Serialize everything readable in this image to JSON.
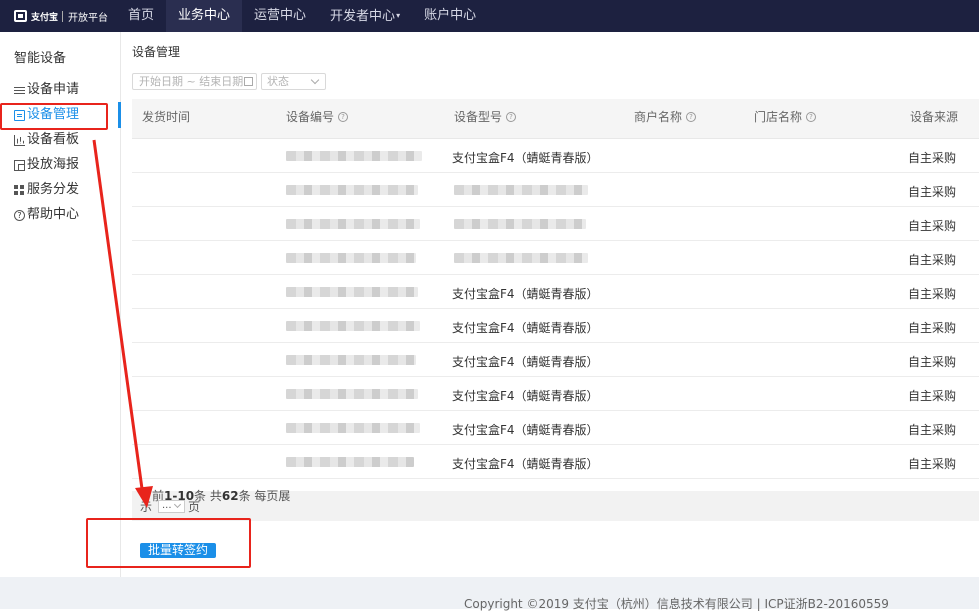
{
  "topnav": {
    "logo_brand": "支付宝",
    "logo_sub": "开放平台",
    "items": [
      {
        "label": "首页"
      },
      {
        "label": "业务中心"
      },
      {
        "label": "运营中心"
      },
      {
        "label": "开发者中心"
      },
      {
        "label": "账户中心"
      }
    ],
    "active_index": 1
  },
  "sidebar": {
    "title": "智能设备",
    "items": [
      {
        "label": "设备申请",
        "icon": "list-icon"
      },
      {
        "label": "设备管理",
        "icon": "document-icon"
      },
      {
        "label": "设备看板",
        "icon": "bar-chart-icon"
      },
      {
        "label": "投放海报",
        "icon": "poster-icon"
      },
      {
        "label": "服务分发",
        "icon": "grid-icon"
      },
      {
        "label": "帮助中心",
        "icon": "help-icon"
      }
    ],
    "active_index": 1
  },
  "main": {
    "title": "设备管理",
    "filters": {
      "date_placeholder": "开始日期 ~ 结束日期",
      "status_placeholder": "状态"
    },
    "table": {
      "columns": [
        "发货时间",
        "设备编号",
        "设备型号",
        "商户名称",
        "门店名称",
        "设备来源"
      ],
      "rows": [
        {
          "time": "",
          "device_no": "",
          "model": "支付宝盒F4（蜻蜓青春版）",
          "merchant": "",
          "store": "",
          "source": "自主采购"
        },
        {
          "time": "",
          "device_no": "",
          "model": "",
          "merchant": "",
          "store": "",
          "source": "自主采购"
        },
        {
          "time": "",
          "device_no": "",
          "model": "",
          "merchant": "",
          "store": "",
          "source": "自主采购"
        },
        {
          "time": "",
          "device_no": "",
          "model": "",
          "merchant": "",
          "store": "",
          "source": "自主采购"
        },
        {
          "time": "",
          "device_no": "",
          "model": "支付宝盒F4（蜻蜓青春版）",
          "merchant": "",
          "store": "",
          "source": "自主采购"
        },
        {
          "time": "",
          "device_no": "",
          "model": "支付宝盒F4（蜻蜓青春版）",
          "merchant": "",
          "store": "",
          "source": "自主采购"
        },
        {
          "time": "",
          "device_no": "",
          "model": "支付宝盒F4（蜻蜓青春版）",
          "merchant": "",
          "store": "",
          "source": "自主采购"
        },
        {
          "time": "",
          "device_no": "",
          "model": "支付宝盒F4（蜻蜓青春版）",
          "merchant": "",
          "store": "",
          "source": "自主采购"
        },
        {
          "time": "",
          "device_no": "",
          "model": "支付宝盒F4（蜻蜓青春版）",
          "merchant": "",
          "store": "",
          "source": "自主采购"
        },
        {
          "time": "",
          "device_no": "",
          "model": "支付宝盒F4（蜻蜓青春版）",
          "merchant": "",
          "store": "",
          "source": "自主采购"
        }
      ]
    },
    "pager": {
      "prefix": "前",
      "range": "1-10",
      "mid1": "条 共",
      "total": "62",
      "mid2": "条 每页展",
      "line2_prefix": "示",
      "page_size": "...",
      "suffix": "页"
    },
    "batch_button": "批量转签约"
  },
  "footer": {
    "text": "Copyright ©2019 支付宝（杭州）信息技术有限公司  |  ICP证浙B2-20160559"
  },
  "annotation_color": "#e8241c"
}
